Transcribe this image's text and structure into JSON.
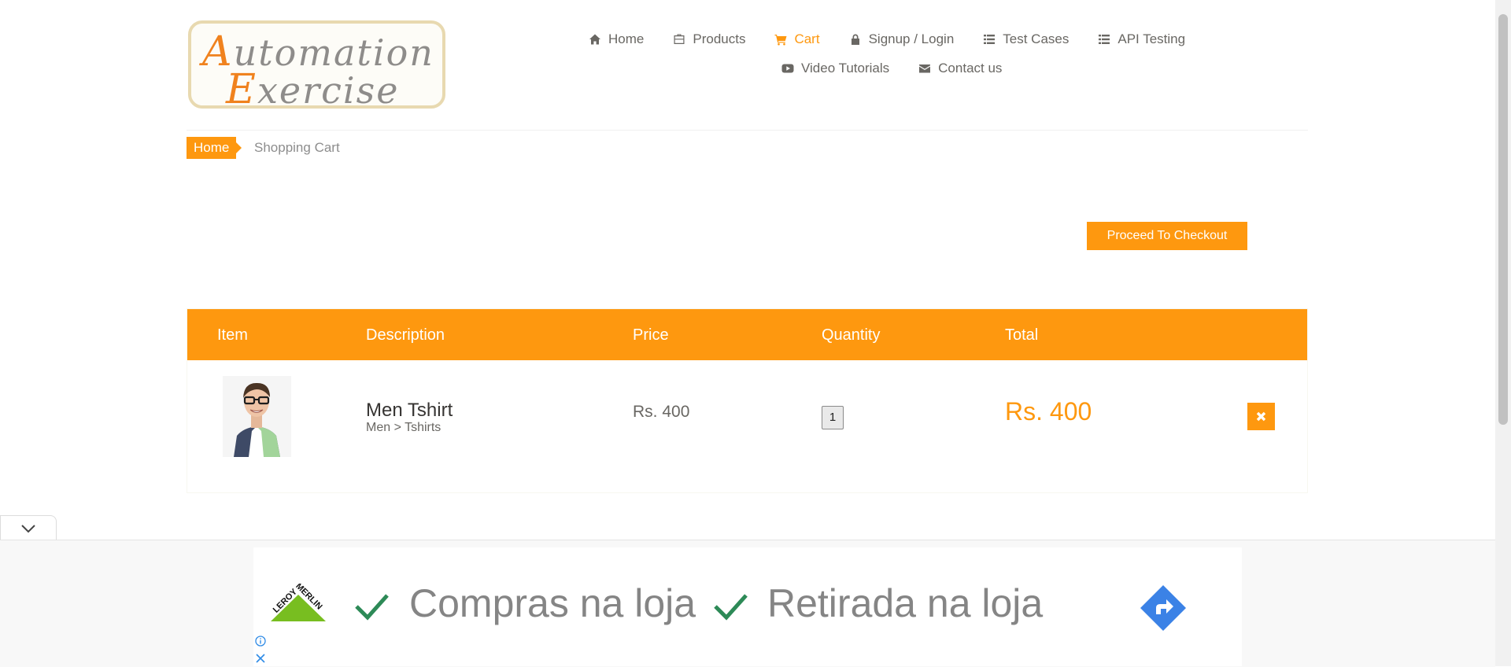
{
  "logo": {
    "line1_cap": "A",
    "line1_rest": "utomation",
    "line2_cap": "E",
    "line2_rest": "xercise"
  },
  "nav": {
    "row1": [
      {
        "label": "Home",
        "icon": "home-icon"
      },
      {
        "label": "Products",
        "icon": "briefcase-icon"
      },
      {
        "label": "Cart",
        "icon": "cart-icon",
        "active": true
      },
      {
        "label": "Signup / Login",
        "icon": "lock-icon"
      },
      {
        "label": "Test Cases",
        "icon": "list-icon"
      },
      {
        "label": "API Testing",
        "icon": "list-icon"
      }
    ],
    "row2": [
      {
        "label": "Video Tutorials",
        "icon": "youtube-icon"
      },
      {
        "label": "Contact us",
        "icon": "envelope-icon"
      }
    ]
  },
  "breadcrumb": {
    "home": "Home",
    "current": "Shopping Cart"
  },
  "checkout_button": "Proceed To Checkout",
  "cart": {
    "headers": {
      "item": "Item",
      "description": "Description",
      "price": "Price",
      "quantity": "Quantity",
      "total": "Total"
    },
    "items": [
      {
        "name": "Men Tshirt",
        "category": "Men > Tshirts",
        "price": "Rs. 400",
        "quantity": "1",
        "total": "Rs. 400",
        "image": "man-with-glasses-photo"
      }
    ]
  },
  "ad": {
    "text1": "Compras na loja",
    "text2": "Retirada na loja",
    "brand_line1": "LEROY",
    "brand_line2": "MERLIN"
  },
  "colors": {
    "accent": "#fe980f",
    "text": "#696763",
    "ad_check": "#2d8a57",
    "ad_nav": "#3b82e6"
  }
}
